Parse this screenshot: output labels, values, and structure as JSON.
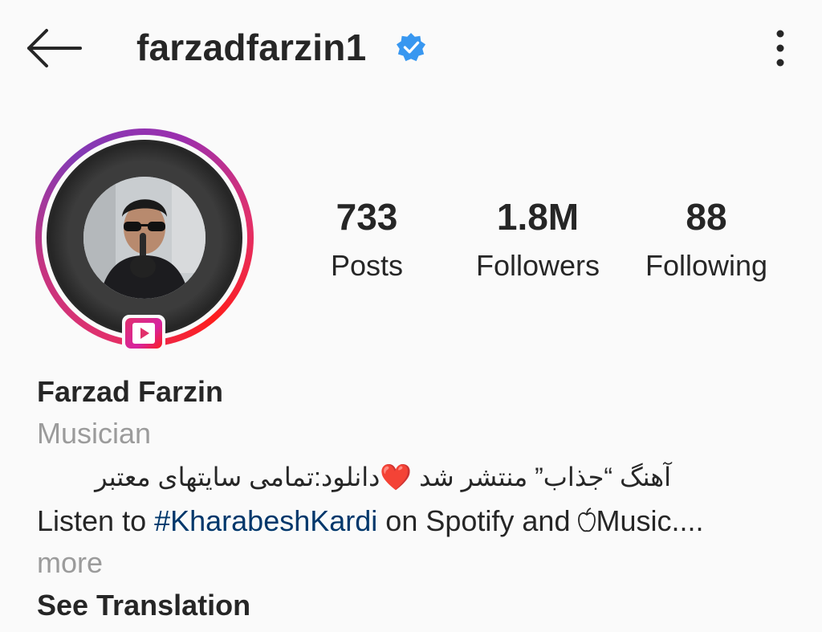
{
  "header": {
    "username": "farzadfarzin1",
    "verified": true,
    "back_icon": "back-arrow-icon",
    "menu_icon": "more-vertical-icon"
  },
  "profile": {
    "avatar_icon": "avatar",
    "igtv_icon": "igtv-play-icon"
  },
  "stats": [
    {
      "value": "733",
      "label": "Posts"
    },
    {
      "value": "1.8M",
      "label": "Followers"
    },
    {
      "value": "88",
      "label": "Following"
    }
  ],
  "bio": {
    "full_name": "Farzad Farzin",
    "category": "Musician",
    "line_fa_a": "آهنگ “جذاب” منتشر شد ",
    "line_fa_heart": "❤️",
    "line_fa_b": "دانلود:تمامی سایتهای معتبر",
    "line_en_before": "Listen to ",
    "hashtag": "#KharabeshKardi",
    "line_en_after": " on Spotify and ",
    "line_en_end": "Music....",
    "more": "more",
    "see_translation": "See Translation"
  },
  "colors": {
    "background": "#fafafa",
    "text": "#262626",
    "muted": "#9b9b9b",
    "hashtag": "#00376b",
    "verified": "#3897f0",
    "ring_gradient": [
      "#833ab4",
      "#c13584",
      "#e1306c",
      "#fd1d1d"
    ]
  }
}
